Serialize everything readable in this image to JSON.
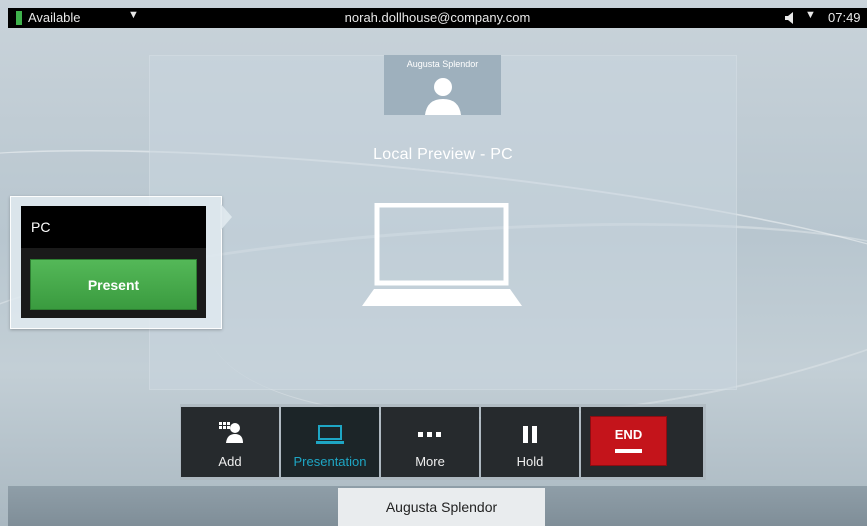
{
  "status": {
    "label": "Available",
    "color": "#3fb24c"
  },
  "header": {
    "user_email": "norah.dollhouse@company.com",
    "time": "07:49"
  },
  "preview": {
    "self_name": "Augusta Splendor",
    "title": "Local Preview - PC"
  },
  "source_popup": {
    "source_name": "PC",
    "present_label": "Present"
  },
  "toolbar": {
    "add_label": "Add",
    "presentation_label": "Presentation",
    "more_label": "More",
    "hold_label": "Hold",
    "end_label": "END",
    "accent_color": "#1ea6c4",
    "end_color": "#c4141b"
  },
  "participant": {
    "name": "Augusta Splendor"
  },
  "icons": [
    "caret-down-icon",
    "speaker-icon",
    "avatar-icon",
    "laptop-icon",
    "add-contact-icon",
    "presentation-icon",
    "more-icon",
    "pause-icon"
  ]
}
